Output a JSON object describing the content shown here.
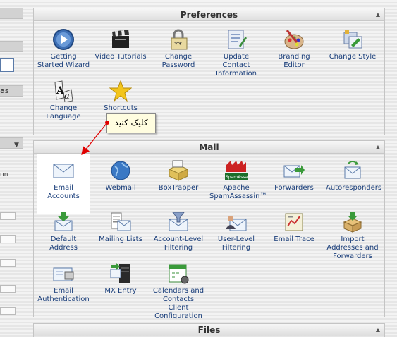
{
  "sidebar": {
    "partial_text_1": "as",
    "partial_text_2": "nn"
  },
  "preferences": {
    "title": "Preferences",
    "items": [
      {
        "label": "Getting Started Wizard",
        "icon": "play-icon"
      },
      {
        "label": "Video Tutorials",
        "icon": "clapperboard-icon"
      },
      {
        "label": "Change Password",
        "icon": "lock-icon"
      },
      {
        "label": "Update Contact Information",
        "icon": "contact-card-icon"
      },
      {
        "label": "Branding Editor",
        "icon": "palette-icon"
      },
      {
        "label": "Change Style",
        "icon": "style-icon"
      },
      {
        "label": "Change Language",
        "icon": "language-icon"
      },
      {
        "label": "Shortcuts",
        "icon": "star-icon"
      }
    ]
  },
  "mail": {
    "title": "Mail",
    "items": [
      {
        "label": "Email Accounts",
        "icon": "envelope-icon"
      },
      {
        "label": "Webmail",
        "icon": "globe-icon"
      },
      {
        "label": "BoxTrapper",
        "icon": "boxtrapper-icon"
      },
      {
        "label": "Apache SpamAssassin™",
        "icon": "spamassassin-icon"
      },
      {
        "label": "Forwarders",
        "icon": "forward-icon"
      },
      {
        "label": "Autoresponders",
        "icon": "autoresponder-icon"
      },
      {
        "label": "Default Address",
        "icon": "default-address-icon"
      },
      {
        "label": "Mailing Lists",
        "icon": "mailing-list-icon"
      },
      {
        "label": "Account-Level Filtering",
        "icon": "filter-icon"
      },
      {
        "label": "User-Level Filtering",
        "icon": "user-filter-icon"
      },
      {
        "label": "Email Trace",
        "icon": "trace-icon"
      },
      {
        "label": "Import Addresses and Forwarders",
        "icon": "import-icon"
      },
      {
        "label": "Email Authentication",
        "icon": "authentication-icon"
      },
      {
        "label": "MX Entry",
        "icon": "server-icon"
      },
      {
        "label": "Calendars and Contacts Client Configuration",
        "icon": "calendar-icon"
      }
    ]
  },
  "files": {
    "title": "Files"
  },
  "annotation": {
    "callout_text": "کلیک کنید",
    "arrow_color": "#e00000",
    "highlight_color": "#ffffff"
  }
}
